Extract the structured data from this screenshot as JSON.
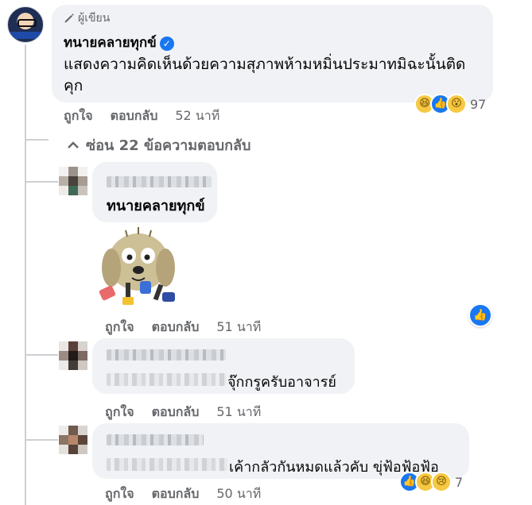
{
  "main_comment": {
    "author_tag": "ผู้เขียน",
    "author_name": "ทนายคลายทุกข์",
    "text_line1": "แสดงความคิดเห็นด้วยความสุภาพห้ามหมิ่นประมาทมิฉะนั้นติด",
    "text_line2": "คุก",
    "like_label": "ถูกใจ",
    "reply_label": "ตอบกลับ",
    "time": "52 นาที",
    "reaction_count": "97",
    "reactions": [
      "haha-icon",
      "like-icon",
      "wow-icon"
    ]
  },
  "replies_toggle": {
    "label": "ซ่อน 22 ข้อความตอบกลับ",
    "icon": "chevron-up-icon"
  },
  "replies": [
    {
      "mention": "ทนายคลายทุกข์",
      "has_sticker": true,
      "like_label": "ถูกใจ",
      "reply_label": "ตอบกลับ",
      "time": "51 นาที"
    },
    {
      "text_visible": "จุ๊กกรูครับอาจารย์",
      "like_label": "ถูกใจ",
      "reply_label": "ตอบกลับ",
      "time": "51 นาที"
    },
    {
      "text_visible": "เค้ากลัวกันหมดแล้วคับ ขุ่ฟ้อฟ้อฟ้อ",
      "like_label": "ถูกใจ",
      "reply_label": "ตอบกลับ",
      "time": "50 นาที",
      "reaction_count": "7",
      "reactions": [
        "like-icon",
        "haha-icon",
        "sad-icon"
      ]
    }
  ],
  "colors": {
    "bubble": "#f0f2f5",
    "secondary_text": "#65676b",
    "like_blue": "#1877f2",
    "emoji_yellow": "#f7c842"
  }
}
